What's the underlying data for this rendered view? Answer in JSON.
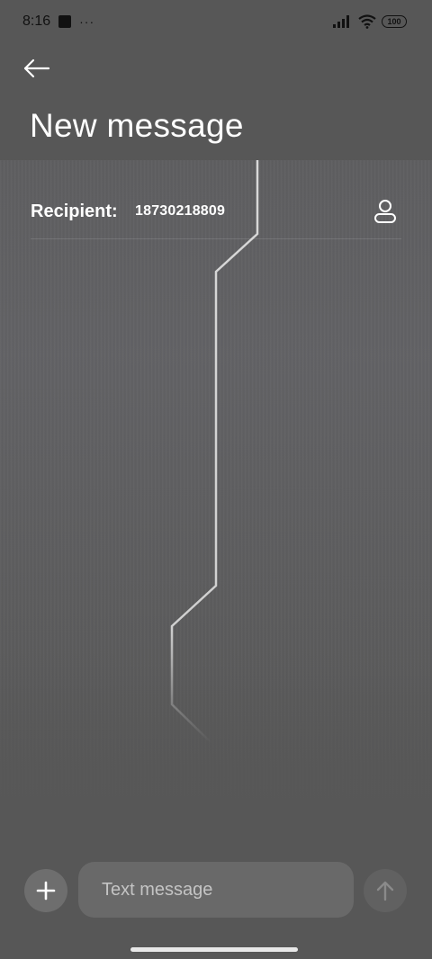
{
  "status_bar": {
    "time": "8:16",
    "dots": "···",
    "battery": "100",
    "icons": [
      "app-notification-icon",
      "signal-icon",
      "wifi-icon",
      "battery-icon"
    ]
  },
  "header": {
    "back_icon": "arrow-left-icon",
    "title": "New message"
  },
  "recipient": {
    "label": "Recipient:",
    "value": "18730218809",
    "contact_icon": "person-icon"
  },
  "composer": {
    "attach_icon": "plus-icon",
    "placeholder": "Text message",
    "value": "",
    "send_icon": "arrow-up-icon"
  },
  "colors": {
    "background": "#575757",
    "text": "#ffffff",
    "input": "#696969",
    "button": "#6e6e6e"
  }
}
